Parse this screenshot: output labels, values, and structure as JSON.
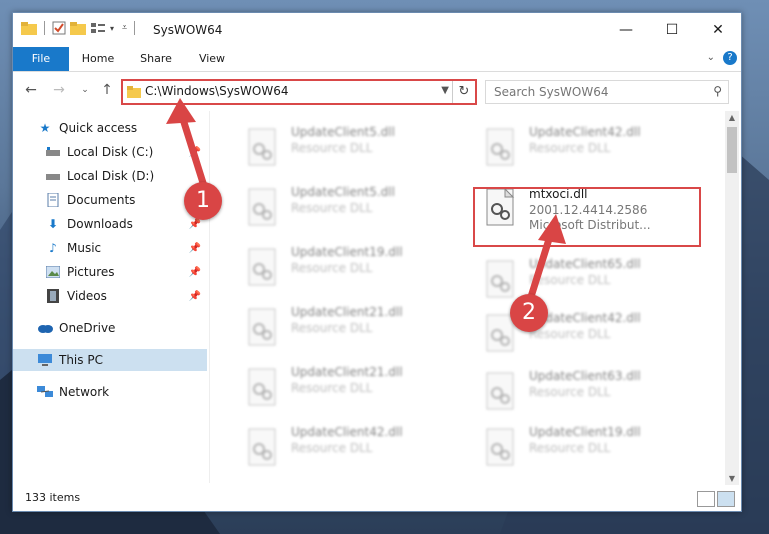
{
  "window": {
    "title": "SysWOW64",
    "controls": [
      "—",
      "☐",
      "✕"
    ]
  },
  "ribbon": {
    "tabs": [
      "File",
      "Home",
      "Share",
      "View"
    ]
  },
  "address": {
    "path": "C:\\Windows\\SysWOW64"
  },
  "search": {
    "placeholder": "Search SysWOW64"
  },
  "nav": {
    "items": [
      {
        "label": "Quick access",
        "icon": "star-icon",
        "pinned": false
      },
      {
        "label": "Local Disk (C:)",
        "icon": "drive-icon",
        "pinned": true
      },
      {
        "label": "Local Disk (D:)",
        "icon": "drive-icon",
        "pinned": false
      },
      {
        "label": "Documents",
        "icon": "documents-icon",
        "pinned": true
      },
      {
        "label": "Downloads",
        "icon": "download-icon",
        "pinned": true
      },
      {
        "label": "Music",
        "icon": "music-icon",
        "pinned": true
      },
      {
        "label": "Pictures",
        "icon": "pictures-icon",
        "pinned": true
      },
      {
        "label": "Videos",
        "icon": "videos-icon",
        "pinned": true
      },
      {
        "label": "OneDrive",
        "icon": "cloud-icon",
        "pinned": false
      },
      {
        "label": "This PC",
        "icon": "computer-icon",
        "pinned": false
      },
      {
        "label": "Network",
        "icon": "network-icon",
        "pinned": false
      }
    ]
  },
  "files": {
    "left_column": [
      {
        "name": "UpdateClient5.dll",
        "type": "Resource DLL"
      },
      {
        "name": "UpdateClient5.dll",
        "type": "Resource DLL"
      },
      {
        "name": "UpdateClient19.dll",
        "type": "Resource DLL"
      },
      {
        "name": "UpdateClient21.dll",
        "type": "Resource DLL"
      },
      {
        "name": "UpdateClient21.dll",
        "type": "Resource DLL"
      },
      {
        "name": "UpdateClient42.dll",
        "type": "Resource DLL"
      }
    ],
    "right_column": [
      {
        "name": "UpdateClient42.dll",
        "type": "Resource DLL"
      },
      {
        "name": "UpdateClient65.dll",
        "type": "Resource DLL"
      },
      {
        "name": "UpdateClient42.dll",
        "type": "Resource DLL"
      },
      {
        "name": "UpdateClient63.dll",
        "type": "Resource DLL"
      },
      {
        "name": "UpdateClient19.dll",
        "type": "Resource DLL"
      }
    ],
    "highlighted": {
      "name": "mtxoci.dll",
      "version": "2001.12.4414.2586",
      "description": "Microsoft Distribut..."
    }
  },
  "status": {
    "item_count": "133 items"
  },
  "annotations": {
    "step1": "1",
    "step2": "2"
  },
  "colors": {
    "accent": "#1979ca",
    "highlight": "#d94848",
    "selected": "#cce0f0"
  }
}
